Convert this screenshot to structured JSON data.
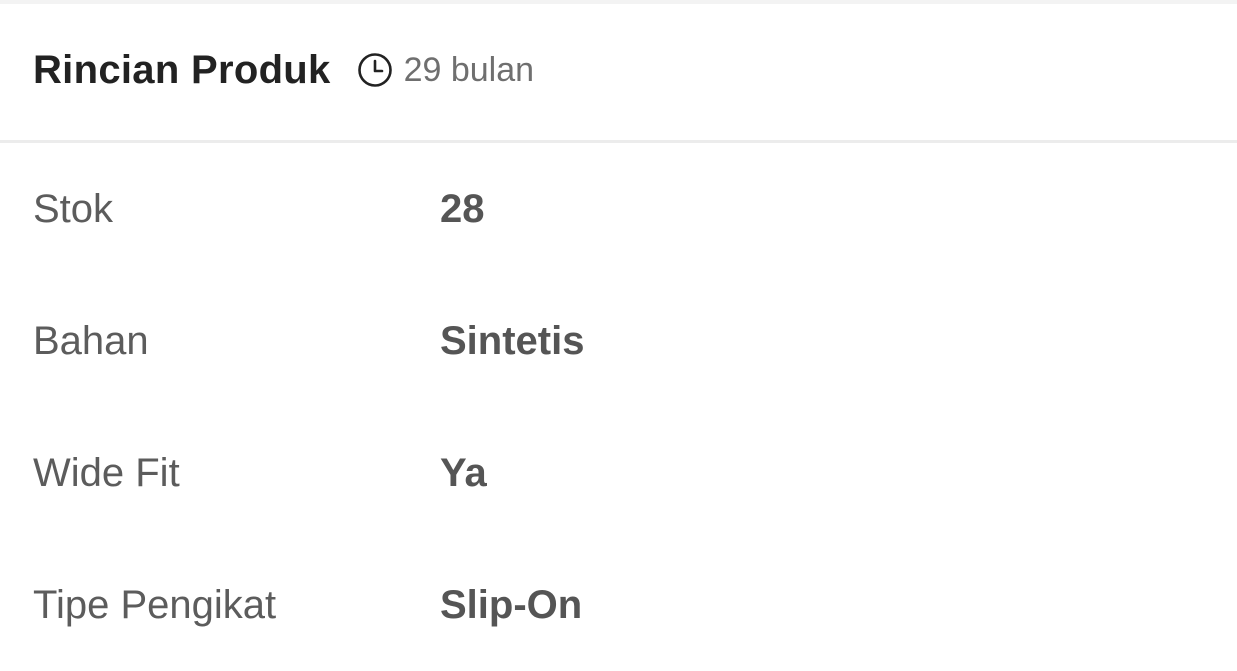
{
  "header": {
    "title": "Rincian Produk",
    "age_icon": "clock-icon",
    "age_text": "29 bulan"
  },
  "details": [
    {
      "label": "Stok",
      "value": "28"
    },
    {
      "label": "Bahan",
      "value": "Sintetis"
    },
    {
      "label": "Wide Fit",
      "value": "Ya"
    },
    {
      "label": "Tipe Pengikat",
      "value": "Slip-On"
    }
  ],
  "colors": {
    "title": "#222222",
    "label": "#5c5c5c",
    "value": "#555555",
    "muted": "#6f6f6f",
    "divider": "#ececec"
  }
}
